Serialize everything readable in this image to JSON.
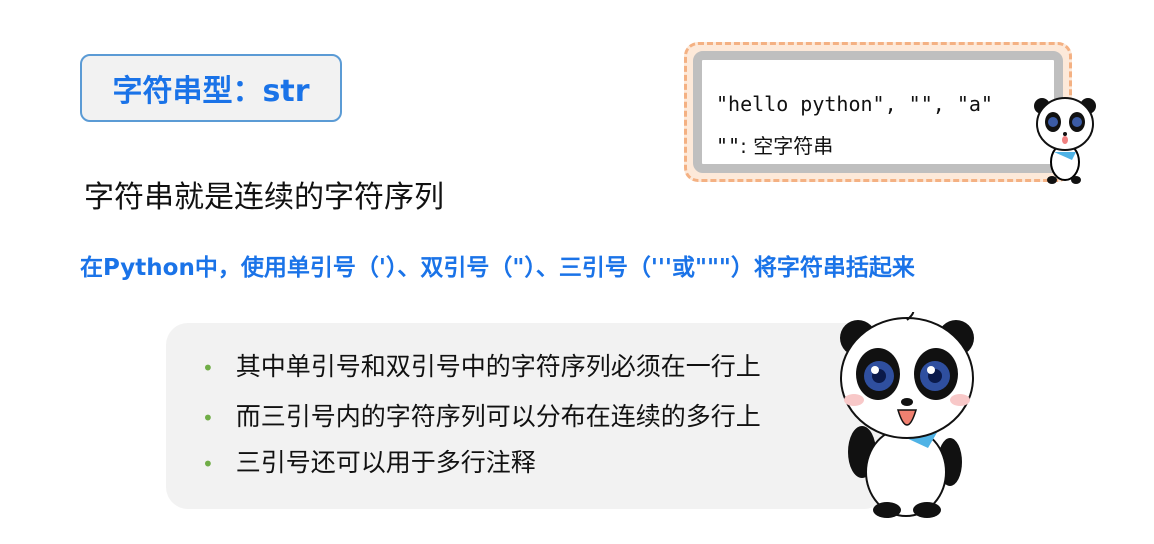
{
  "title": "字符串型：str",
  "code_box": {
    "line1": "\"hello python\", \"\", \"a\"",
    "line2_code": "\"\"",
    "line2_text": ": 空字符串"
  },
  "subtitle": "字符串就是连续的字符序列",
  "description": "在Python中，使用单引号（'）、双引号（\"）、三引号（'''或\"\"\"）将字符串括起来",
  "bullets": [
    "其中单引号和双引号中的字符序列必须在一行上",
    "而三引号内的字符序列可以分布在连续的多行上",
    "三引号还可以用于多行注释"
  ],
  "colors": {
    "accent": "#1a73e8",
    "bullet": "#70ad47",
    "dashed_border": "#f4b183"
  }
}
